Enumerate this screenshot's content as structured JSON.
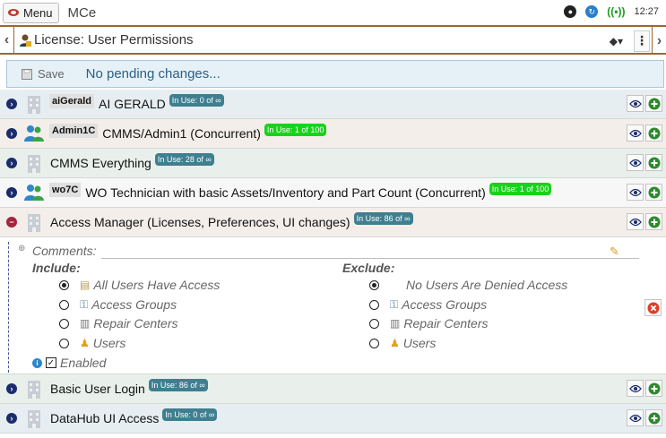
{
  "topbar": {
    "menu_label": "Menu",
    "app_name": "MCe",
    "time": "12:27"
  },
  "title": {
    "text": "License: User Permissions"
  },
  "savebar": {
    "save_label": "Save",
    "status": "No pending changes..."
  },
  "rows": [
    {
      "code": "aiGerald",
      "name": "AI GERALD",
      "badge": "In Use: 0 of ∞"
    },
    {
      "code": "Admin1C",
      "name": "CMMS/Admin1 (Concurrent)",
      "badge": "In Use: 1 of 100"
    },
    {
      "code": "",
      "name": "CMMS Everything",
      "badge": "In Use: 28 of ∞"
    },
    {
      "code": "wo7C",
      "name": "WO Technician with basic Assets/Inventory and Part Count (Concurrent)",
      "badge": "In Use: 1 of 100"
    },
    {
      "code": "",
      "name": "Access Manager (Licenses, Preferences, UI changes)",
      "badge": "In Use: 86 of ∞"
    },
    {
      "code": "",
      "name": "Basic User Login",
      "badge": "In Use: 86 of ∞"
    },
    {
      "code": "",
      "name": "DataHub UI Access",
      "badge": "In Use: 0 of ∞"
    }
  ],
  "detail": {
    "comments_label": "Comments:",
    "include_label": "Include:",
    "exclude_label": "Exclude:",
    "include_options": [
      "All Users Have Access",
      "Access Groups",
      "Repair Centers",
      "Users"
    ],
    "exclude_options": [
      "No Users Are Denied Access",
      "Access Groups",
      "Repair Centers",
      "Users"
    ],
    "enabled_label": "Enabled"
  },
  "colors": {
    "accent_border": "#a0662e",
    "badge_teal": "#3f7f8f",
    "badge_green": "#19d21b",
    "expander": "#1a2c6b",
    "add_green": "#2c8a2c"
  }
}
